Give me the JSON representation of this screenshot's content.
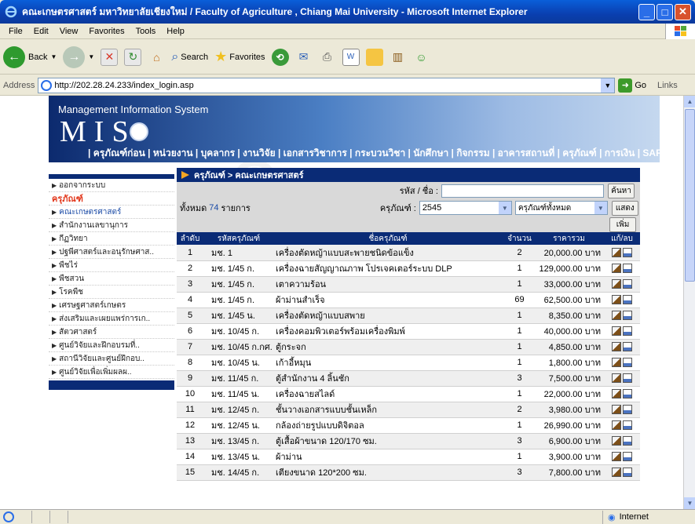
{
  "window": {
    "title": "คณะเกษตรศาสตร์ มหาวิทยาลัยเชียงใหม่ / Faculty of Agriculture , Chiang Mai University   - Microsoft Internet Explorer"
  },
  "menu": [
    "File",
    "Edit",
    "View",
    "Favorites",
    "Tools",
    "Help"
  ],
  "toolbar": {
    "back": "Back",
    "search": "Search",
    "favorites": "Favorites"
  },
  "address": {
    "label": "Address",
    "url": "http://202.28.24.233/index_login.asp",
    "go": "Go",
    "links": "Links"
  },
  "status": {
    "zone": "Internet"
  },
  "header": {
    "system_name": "Management Information System",
    "logo": "MIS",
    "nav": "| ครุภัณฑ์ก่อน | หน่วยงาน | บุคลากร | งานวิจัย | เอกสารวิชาการ | กระบวนวิชา | นักศึกษา | กิจกรรม | อาคารสถานที่ | ครุภัณฑ์ | การเงิน | SAR"
  },
  "sidebar": {
    "items": [
      {
        "label": "ออกจากระบบ",
        "type": "normal"
      },
      {
        "label": "ครุภัณฑ์",
        "type": "active"
      },
      {
        "label": "คณะเกษตรศาสตร์",
        "type": "sub"
      },
      {
        "label": "สำนักงานเลขานุการ",
        "type": "normal"
      },
      {
        "label": "กีฏวิทยา",
        "type": "normal"
      },
      {
        "label": "ปฐพีศาสตร์และอนุรักษศาส..",
        "type": "normal"
      },
      {
        "label": "พืชไร่",
        "type": "normal"
      },
      {
        "label": "พืชสวน",
        "type": "normal"
      },
      {
        "label": "โรคพืช",
        "type": "normal"
      },
      {
        "label": "เศรษฐศาสตร์เกษตร",
        "type": "normal"
      },
      {
        "label": "ส่งเสริมและเผยแพร่การเก..",
        "type": "normal"
      },
      {
        "label": "สัตวศาสตร์",
        "type": "normal"
      },
      {
        "label": "ศูนย์วิจัยและฝึกอบรมที่..",
        "type": "normal"
      },
      {
        "label": "สถานีวิจัยและศูนย์ฝึกอบ..",
        "type": "normal"
      },
      {
        "label": "ศูนย์วิจัยเพื่อเพิ่มผลผ..",
        "type": "normal"
      }
    ]
  },
  "main": {
    "breadcrumb": "ครุภัณฑ์ > คณะเกษตรศาสตร์",
    "search_label": "รหัส / ชื่อ :",
    "search_value": "",
    "search_button": "ค้นหา",
    "total_prefix": "ทั้งหมด",
    "total_count": "74",
    "total_suffix": "รายการ",
    "year_label": "ครุภัณฑ์ :",
    "year_value": "2545",
    "filter_value": "ครุภัณฑ์ทั้งหมด",
    "show_button": "แสดง",
    "add_button": "เพิ่ม",
    "columns": [
      "ลำดับ",
      "รหัสครุภัณฑ์",
      "ชื่อครุภัณฑ์",
      "จำนวน",
      "ราคารวม",
      "แก้/ลบ"
    ],
    "rows": [
      {
        "no": "1",
        "code": "มช. 1",
        "name": "เครื่องตัดหญ้าแบบสะพายชนิดข้อแข็ง",
        "qty": "2",
        "price": "20,000.00 บาท"
      },
      {
        "no": "2",
        "code": "มช. 1/45 ก.",
        "name": "เครื่องฉายสัญญาณภาพ โปรเจคเตอร์ระบบ DLP",
        "qty": "1",
        "price": "129,000.00 บาท"
      },
      {
        "no": "3",
        "code": "มช. 1/45 ก.",
        "name": "เตาความร้อน",
        "qty": "1",
        "price": "33,000.00 บาท"
      },
      {
        "no": "4",
        "code": "มช. 1/45 ก.",
        "name": "ผ้าม่านสำเร็จ",
        "qty": "69",
        "price": "62,500.00 บาท"
      },
      {
        "no": "5",
        "code": "มช. 1/45 น.",
        "name": "เครื่องตัดหญ้าแบบสพาย",
        "qty": "1",
        "price": "8,350.00 บาท"
      },
      {
        "no": "6",
        "code": "มช. 10/45 ก.",
        "name": "เครื่องคอมพิวเตอร์พร้อมเครื่องพิมพ์",
        "qty": "1",
        "price": "40,000.00 บาท"
      },
      {
        "no": "7",
        "code": "มช. 10/45 ก.กศ.",
        "name": "ตู้กระจก",
        "qty": "1",
        "price": "4,850.00 บาท"
      },
      {
        "no": "8",
        "code": "มช. 10/45 น.",
        "name": "เก้าอี้หมุน",
        "qty": "1",
        "price": "1,800.00 บาท"
      },
      {
        "no": "9",
        "code": "มช. 11/45 ก.",
        "name": "ตู้สำนักงาน 4 ลิ้นชัก",
        "qty": "3",
        "price": "7,500.00 บาท"
      },
      {
        "no": "10",
        "code": "มช. 11/45 น.",
        "name": "เครื่องฉายสไลด์",
        "qty": "1",
        "price": "22,000.00 บาท"
      },
      {
        "no": "11",
        "code": "มช. 12/45 ก.",
        "name": "ชั้นวางเอกสารแบบชั้นเหล็ก",
        "qty": "2",
        "price": "3,980.00 บาท"
      },
      {
        "no": "12",
        "code": "มช. 12/45 น.",
        "name": "กล้องถ่ายรูปแบบดิจิตอล",
        "qty": "1",
        "price": "26,990.00 บาท"
      },
      {
        "no": "13",
        "code": "มช. 13/45 ก.",
        "name": "ตู้เสื้อผ้าขนาด 120/170 ซม.",
        "qty": "3",
        "price": "6,900.00 บาท"
      },
      {
        "no": "14",
        "code": "มช. 13/45 น.",
        "name": "ผ้าม่าน",
        "qty": "1",
        "price": "3,900.00 บาท"
      },
      {
        "no": "15",
        "code": "มช. 14/45 ก.",
        "name": "เตียงขนาด 120*200 ซม.",
        "qty": "3",
        "price": "7,800.00 บาท"
      }
    ]
  }
}
